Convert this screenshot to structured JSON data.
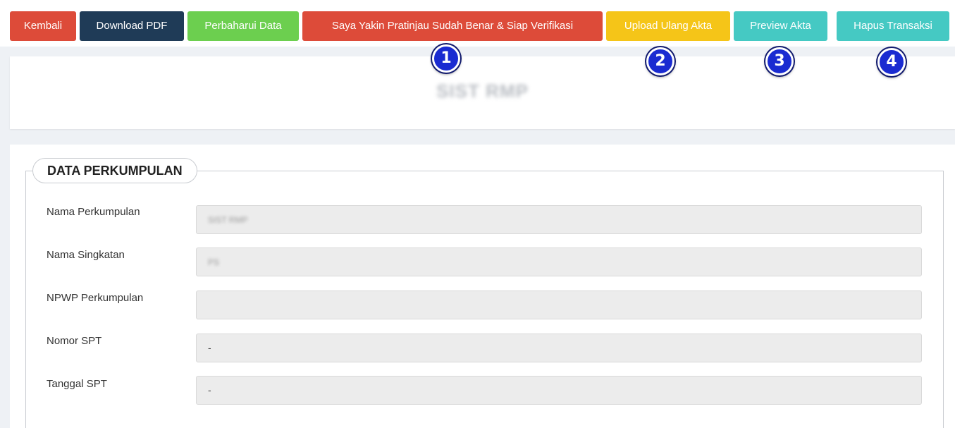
{
  "toolbar": {
    "buttons": [
      {
        "label": "Kembali",
        "color": "#dd4b39"
      },
      {
        "label": "Download PDF",
        "color": "#1f3b57"
      },
      {
        "label": "Perbaharui Data",
        "color": "#6ccf4f"
      },
      {
        "label": "Saya Yakin Pratinjau Sudah Benar & Siap Verifikasi",
        "color": "#dd4b39"
      },
      {
        "label": "Upload Ulang Akta",
        "color": "#f5c518"
      },
      {
        "label": "Preview Akta",
        "color": "#45c9c3"
      },
      {
        "label": "Hapus Transaksi",
        "color": "#45c9c3"
      }
    ]
  },
  "badges": [
    "1",
    "2",
    "3",
    "4"
  ],
  "header": {
    "title": "SIST RMP"
  },
  "section": {
    "legend": "DATA PERKUMPULAN",
    "fields": [
      {
        "label": "Nama Perkumpulan",
        "value": "SIST RMP"
      },
      {
        "label": "Nama Singkatan",
        "value": "PS"
      },
      {
        "label": "NPWP Perkumpulan",
        "value": ""
      },
      {
        "label": "Nomor SPT",
        "value": "-"
      },
      {
        "label": "Tanggal SPT",
        "value": "-"
      }
    ]
  }
}
